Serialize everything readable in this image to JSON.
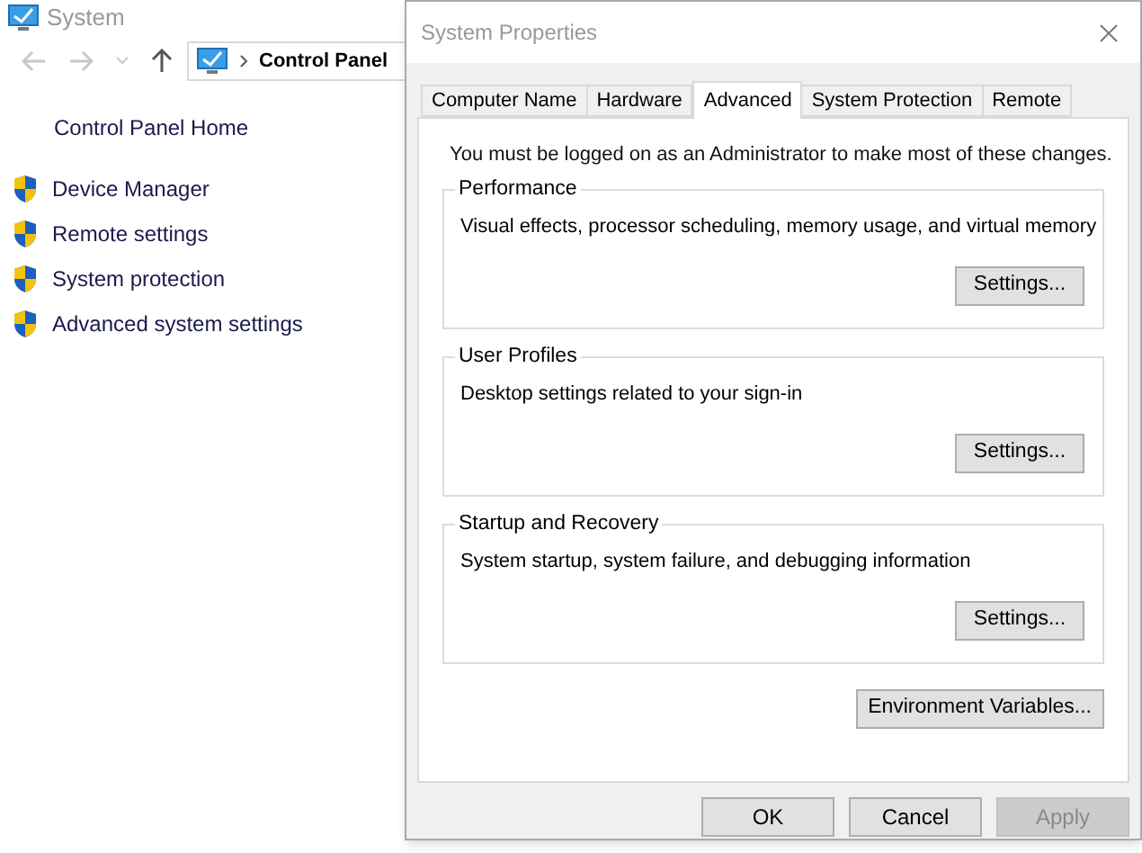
{
  "background_window": {
    "title": "System",
    "breadcrumb": "Control Panel",
    "home_link": "Control Panel Home",
    "links": [
      {
        "label": "Device Manager"
      },
      {
        "label": "Remote settings"
      },
      {
        "label": "System protection"
      },
      {
        "label": "Advanced system settings"
      }
    ]
  },
  "dialog": {
    "title": "System Properties",
    "tabs": [
      {
        "label": "Computer Name",
        "selected": false
      },
      {
        "label": "Hardware",
        "selected": false
      },
      {
        "label": "Advanced",
        "selected": true
      },
      {
        "label": "System Protection",
        "selected": false
      },
      {
        "label": "Remote",
        "selected": false
      }
    ],
    "notice": "You must be logged on as an Administrator to make most of these changes.",
    "groups": [
      {
        "title": "Performance",
        "description": "Visual effects, processor scheduling, memory usage, and virtual memory",
        "button": "Settings..."
      },
      {
        "title": "User Profiles",
        "description": "Desktop settings related to your sign-in",
        "button": "Settings..."
      },
      {
        "title": "Startup and Recovery",
        "description": "System startup, system failure, and debugging information",
        "button": "Settings..."
      }
    ],
    "env_button": "Environment Variables...",
    "buttons": [
      {
        "label": "OK",
        "disabled": false
      },
      {
        "label": "Cancel",
        "disabled": false
      },
      {
        "label": "Apply",
        "disabled": true
      }
    ]
  }
}
